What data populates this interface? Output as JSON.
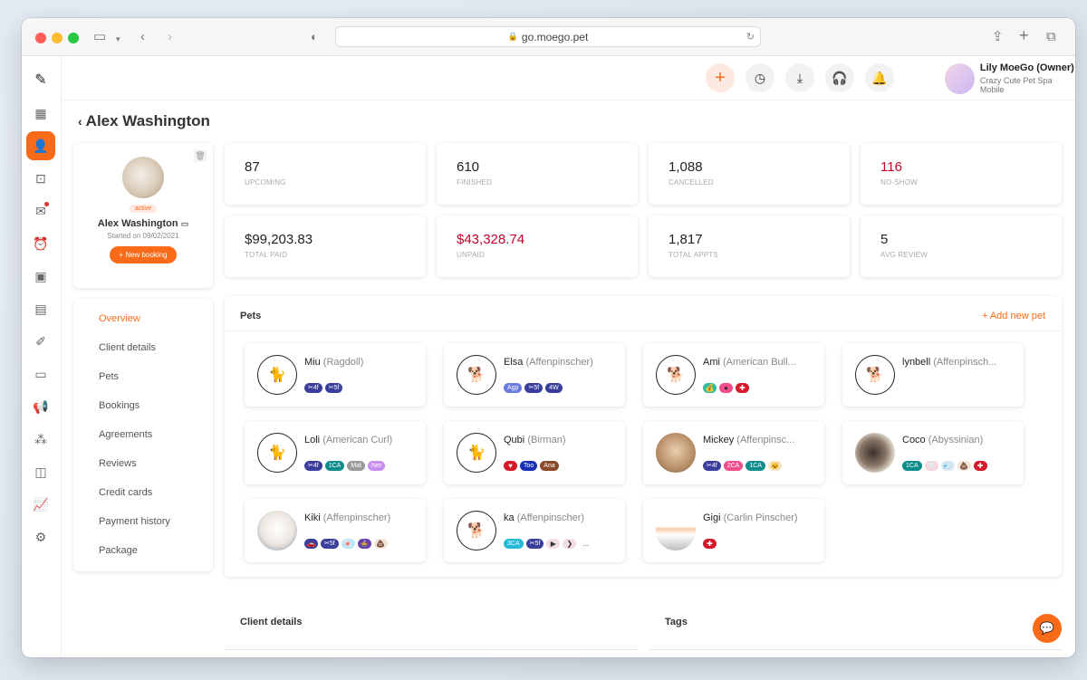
{
  "browser": {
    "url": "go.moego.pet"
  },
  "header": {
    "owner_name": "Lily MoeGo (Owner)",
    "business": "Crazy Cute Pet Spa Mobile",
    "icons": [
      "plus-icon",
      "clock-icon",
      "download-icon",
      "headset-icon",
      "bell-icon"
    ]
  },
  "page": {
    "title": "Alex Washington"
  },
  "profile": {
    "status": "active",
    "name": "Alex Washington",
    "since": "Started on 09/02/2021",
    "new_booking": "+ New booking"
  },
  "nav": [
    "Overview",
    "Client details",
    "Pets",
    "Bookings",
    "Agreements",
    "Reviews",
    "Credit cards",
    "Payment history",
    "Package"
  ],
  "stats": [
    {
      "value": "87",
      "label": "UPCOMING",
      "red": false
    },
    {
      "value": "610",
      "label": "FINISHED",
      "red": false
    },
    {
      "value": "1,088",
      "label": "CANCELLED",
      "red": false
    },
    {
      "value": "116",
      "label": "NO-SHOW",
      "red": true
    },
    {
      "value": "$99,203.83",
      "label": "TOTAL PAID",
      "red": false
    },
    {
      "value": "$43,328.74",
      "label": "UNPAID",
      "red": true
    },
    {
      "value": "1,817",
      "label": "TOTAL APPTS",
      "red": false
    },
    {
      "value": "5",
      "label": "AVG REVIEW",
      "red": false
    }
  ],
  "pets_section": {
    "title": "Pets",
    "add": "+ Add new pet"
  },
  "pets": [
    {
      "name": "Miu",
      "breed": "(Ragdoll)",
      "avatar": "cat-icon",
      "tags": [
        {
          "t": "✂4f",
          "c": "#3b3f9c"
        },
        {
          "t": "✂5f",
          "c": "#3b3f9c"
        }
      ]
    },
    {
      "name": "Elsa",
      "breed": "(Affenpinscher)",
      "avatar": "dog-icon",
      "tags": [
        {
          "t": "Agp",
          "c": "#6c7be0"
        },
        {
          "t": "✂5f",
          "c": "#3b3f9c"
        },
        {
          "t": "4W",
          "c": "#3b3f9c"
        }
      ]
    },
    {
      "name": "Ami",
      "breed": "(American Bull...",
      "avatar": "dog-icon",
      "tags": [
        {
          "t": "💰",
          "c": "#2fbfa0"
        },
        {
          "t": "●",
          "c": "#ef4d8c"
        },
        {
          "t": "✚",
          "c": "#d6182b"
        }
      ]
    },
    {
      "name": "lynbell",
      "breed": "(Affenpinsch...",
      "avatar": "dog-icon",
      "tags": []
    },
    {
      "name": "Loli",
      "breed": "(American Curl)",
      "avatar": "cat-icon",
      "tags": [
        {
          "t": "✂4f",
          "c": "#3b3f9c"
        },
        {
          "t": "1CA",
          "c": "#0f8c8c"
        },
        {
          "t": "Mat",
          "c": "#9a9a9a"
        },
        {
          "t": "Ner",
          "c": "#c98cf0"
        }
      ]
    },
    {
      "name": "Qubi",
      "breed": "(Birman)",
      "avatar": "cat-icon",
      "tags": [
        {
          "t": "♥",
          "c": "#d6182b"
        },
        {
          "t": "Too",
          "c": "#1a2fb8"
        },
        {
          "t": "Ana",
          "c": "#8a4a2a"
        }
      ]
    },
    {
      "name": "Mickey",
      "breed": "(Affenpinsc...",
      "avatar": "photo-mickey",
      "tags": [
        {
          "t": "✂4f",
          "c": "#3b3f9c"
        },
        {
          "t": "2CA",
          "c": "#ef4d8c"
        },
        {
          "t": "1CA",
          "c": "#0f8c8c"
        },
        {
          "t": "🐱",
          "c": "#f3e3c0"
        }
      ]
    },
    {
      "name": "Coco",
      "breed": "(Abyssinian)",
      "avatar": "photo-coco",
      "tags": [
        {
          "t": "1CA",
          "c": "#0f8c8c"
        },
        {
          "t": "🦷",
          "c": "#f7d6e0"
        },
        {
          "t": "💨",
          "c": "#dde8f5"
        },
        {
          "t": "💩",
          "c": "#f0e6da"
        },
        {
          "t": "✚",
          "c": "#d6182b"
        }
      ]
    },
    {
      "name": "Kiki",
      "breed": "(Affenpinscher)",
      "avatar": "photo-kiki",
      "tags": [
        {
          "t": "🚗",
          "c": "#3b3f9c"
        },
        {
          "t": "✂5f",
          "c": "#3b3f9c"
        },
        {
          "t": "🍬",
          "c": "#bde6f5"
        },
        {
          "t": "🍲",
          "c": "#6b3fb0"
        },
        {
          "t": "💩",
          "c": "#f0e6da"
        }
      ]
    },
    {
      "name": "ka",
      "breed": "(Affenpinscher)",
      "avatar": "dog-icon",
      "tags": [
        {
          "t": "3CA",
          "c": "#22b8d6"
        },
        {
          "t": "✂5f",
          "c": "#3b3f9c"
        },
        {
          "t": "▶",
          "c": "#f4dce4"
        },
        {
          "t": "❯",
          "c": "#f4dce4"
        },
        {
          "t": "...",
          "c": "#ffffff"
        }
      ]
    },
    {
      "name": "Gigi",
      "breed": "(Carlin Pinscher)",
      "avatar": "photo-gigi",
      "tags": [
        {
          "t": "✚",
          "c": "#d6182b"
        }
      ]
    }
  ],
  "bottom": {
    "client_details": "Client details",
    "tags": "Tags"
  },
  "colors": {
    "accent": "#f96b18",
    "red": "#c4002b"
  }
}
